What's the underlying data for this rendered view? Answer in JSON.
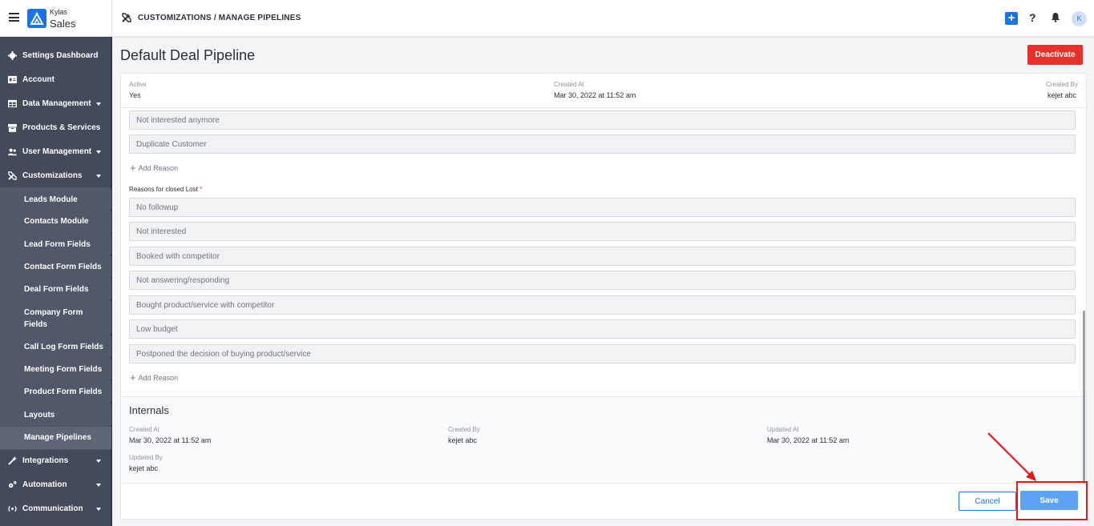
{
  "topbar": {
    "brand_top": "Kylas",
    "brand_bottom": "Sales",
    "breadcrumb": "CUSTOMIZATIONS / MANAGE PIPELINES",
    "plus_label": "+",
    "help_label": "?",
    "avatar_initial": "K"
  },
  "sidebar": {
    "items": [
      {
        "label": "Settings Dashboard",
        "icon": "gear-icon"
      },
      {
        "label": "Account",
        "icon": "id-card-icon"
      },
      {
        "label": "Data Management",
        "icon": "table-icon"
      },
      {
        "label": "Products & Services",
        "icon": "box-icon"
      },
      {
        "label": "User Management",
        "icon": "users-icon"
      },
      {
        "label": "Customizations",
        "icon": "tools-icon"
      },
      {
        "label": "Integrations",
        "icon": "wand-icon"
      },
      {
        "label": "Automation",
        "icon": "cogs-icon"
      },
      {
        "label": "Communication",
        "icon": "broadcast-icon"
      }
    ],
    "sub_items": [
      "Leads Module",
      "Contacts Module",
      "Lead Form Fields",
      "Contact Form Fields",
      "Deal Form Fields",
      "Company Form Fields",
      "Call Log Form Fields",
      "Meeting Form Fields",
      "Product Form Fields",
      "Layouts",
      "Manage Pipelines"
    ]
  },
  "page": {
    "title": "Default Deal Pipeline",
    "deactivate_label": "Deactivate"
  },
  "summary": {
    "active_label": "Active",
    "active_value": "Yes",
    "created_at_label": "Created At",
    "created_at_value": "Mar 30, 2022 at 11:52 am",
    "created_by_label": "Created By",
    "created_by_value": "kejet abc"
  },
  "won_reasons": [
    "Not interested anymore",
    "Duplicate Customer"
  ],
  "add_reason_label": "Add Reason",
  "lost_section": {
    "label": "Reasons for closed Lost",
    "required_mark": "*",
    "reasons": [
      "No followup",
      "Not interested",
      "Booked with competitor",
      "Not answering/responding",
      "Bought product/service with competitor",
      "Low budget",
      "Postponed the decision of buying product/service"
    ]
  },
  "internals": {
    "title": "Internals",
    "created_at_label": "Created At",
    "created_at_value": "Mar 30, 2022 at 11:52 am",
    "created_by_label": "Created By",
    "created_by_value": "kejet abc",
    "updated_at_label": "Updated At",
    "updated_at_value": "Mar 30, 2022 at 11:52 am",
    "updated_by_label": "Updated By",
    "updated_by_value": "kejet abc"
  },
  "footer": {
    "cancel_label": "Cancel",
    "save_label": "Save"
  },
  "colors": {
    "accent": "#1a73e8",
    "danger": "#e8302a",
    "sidebar": "#434a5a",
    "save_disabled": "#5ea3f2",
    "annotation": "#e8171a"
  }
}
